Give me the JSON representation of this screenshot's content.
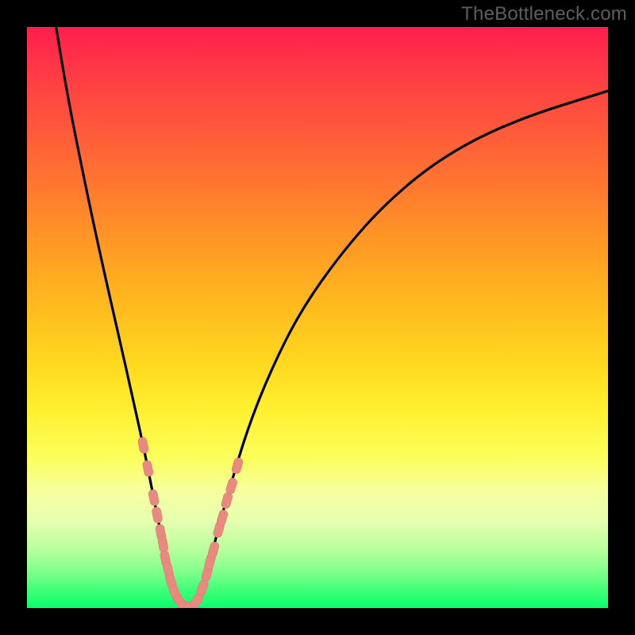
{
  "watermark": {
    "text": "TheBottleneck.com"
  },
  "colors": {
    "curve": "#000000",
    "marker_fill": "#e98a80",
    "marker_stroke": "#de7a70",
    "bg_black": "#000000"
  },
  "chart_data": {
    "type": "line",
    "title": "",
    "xlabel": "",
    "ylabel": "",
    "xlim": [
      0,
      100
    ],
    "ylim": [
      0,
      100
    ],
    "grid": false,
    "legend": false,
    "series": [
      {
        "name": "bottleneck-curve",
        "description": "V-shaped curve; y≈0 at optimum, rises on either side. Left branch near-vertical; right branch rises with diminishing slope.",
        "x": [
          5,
          7,
          10,
          13,
          16,
          18,
          20,
          21,
          22,
          23,
          24,
          25,
          26,
          27,
          28,
          29,
          30,
          31,
          32,
          33,
          35,
          38,
          42,
          47,
          54,
          62,
          72,
          84,
          100
        ],
        "y": [
          100,
          88,
          73,
          59,
          46,
          37,
          28,
          23,
          18,
          13,
          8,
          4,
          1,
          0,
          0,
          1,
          3,
          6,
          10,
          14,
          21,
          31,
          41,
          51,
          61,
          70,
          78,
          84,
          89
        ]
      }
    ],
    "markers": [
      {
        "name": "sample-points",
        "shape": "rounded-rect",
        "branch_hint": "left branch cluster then right branch cluster",
        "x": [
          20.0,
          20.8,
          21.8,
          22.4,
          23.0,
          23.4,
          23.8,
          24.3,
          24.8,
          25.5,
          26.4,
          27.4,
          28.2,
          29.2,
          30.2,
          31.0,
          31.5,
          32.1,
          33.0,
          33.6,
          34.4,
          35.2,
          36.2
        ],
        "y": [
          28.0,
          24.0,
          19.0,
          16.0,
          13.0,
          11.0,
          8.5,
          6.5,
          4.5,
          2.5,
          1.0,
          0.2,
          0.3,
          1.2,
          3.5,
          6.0,
          8.0,
          10.0,
          13.5,
          15.5,
          18.5,
          21.0,
          24.5
        ]
      }
    ]
  }
}
